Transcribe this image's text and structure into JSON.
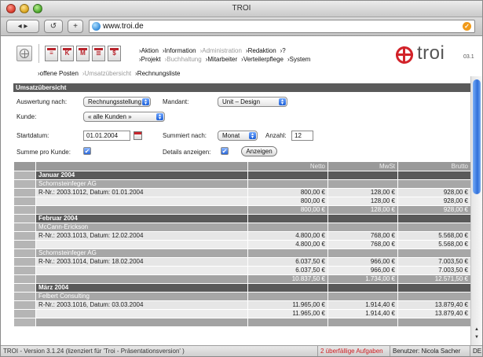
{
  "window": {
    "title": "TROI",
    "back_label": "◂ ▸",
    "reload_label": "↺",
    "add_label": "+",
    "url": "www.troi.de"
  },
  "header": {
    "module_icons": [
      "≡",
      "K",
      "M",
      "≣",
      "$"
    ],
    "menu_row1": [
      {
        "label": "›Aktion",
        "disabled": false
      },
      {
        "label": "›Information",
        "disabled": false
      },
      {
        "label": "›Administration",
        "disabled": true
      },
      {
        "label": "›Redaktion",
        "disabled": false
      },
      {
        "label": "›?",
        "disabled": false
      }
    ],
    "menu_row2": [
      {
        "label": "›Projekt",
        "disabled": false
      },
      {
        "label": "›Buchhaltung",
        "disabled": true
      },
      {
        "label": "›Mitarbeiter",
        "disabled": false
      },
      {
        "label": "›Verteilerpflege",
        "disabled": false
      },
      {
        "label": "›System",
        "disabled": false
      }
    ],
    "logo_text": "troi",
    "logo_version": "03.1"
  },
  "subnav": [
    {
      "label": "›offene Posten",
      "dim": false
    },
    {
      "label": "›Umsatzübersicht",
      "dim": true
    },
    {
      "label": "›Rechnungsliste",
      "dim": false
    }
  ],
  "panel": {
    "title": "Umsatzübersicht"
  },
  "form": {
    "auswertung_label": "Auswertung nach:",
    "auswertung_value": "Rechnungsstellung",
    "mandant_label": "Mandant:",
    "mandant_value": "Unit – Design",
    "kunde_label": "Kunde:",
    "kunde_value": "« alle Kunden »",
    "startdatum_label": "Startdatum:",
    "startdatum_value": "01.01.2004",
    "summiert_label": "Summiert nach:",
    "summiert_value": "Monat",
    "anzahl_label": "Anzahl:",
    "anzahl_value": "12",
    "summe_label": "Summe pro Kunde:",
    "details_label": "Details anzeigen:",
    "anzeigen_label": "Anzeigen",
    "checkmark": "✔"
  },
  "table": {
    "columns": [
      "",
      "",
      "Netto",
      "MwSt",
      "Brutto"
    ],
    "rows": [
      {
        "type": "month",
        "label": "Januar 2004",
        "netto": "",
        "mwst": "",
        "brutto": ""
      },
      {
        "type": "cust",
        "label": "Schornsteinfeger AG",
        "netto": "",
        "mwst": "",
        "brutto": ""
      },
      {
        "type": "inv",
        "label": "R-Nr.: 2003.1012, Datum: 01.01.2004",
        "netto": "800,00 €",
        "mwst": "128,00 €",
        "brutto": "928,00 €"
      },
      {
        "type": "sub",
        "label": "",
        "netto": "800,00 €",
        "mwst": "128,00 €",
        "brutto": "928,00 €"
      },
      {
        "type": "tot",
        "label": "",
        "netto": "800,00 €",
        "mwst": "128,00 €",
        "brutto": "928,00 €"
      },
      {
        "type": "month",
        "label": "Februar 2004",
        "netto": "",
        "mwst": "",
        "brutto": ""
      },
      {
        "type": "cust",
        "label": "McCann-Erickson",
        "netto": "",
        "mwst": "",
        "brutto": ""
      },
      {
        "type": "inv",
        "label": "R-Nr.: 2003.1013, Datum: 12.02.2004",
        "netto": "4.800,00 €",
        "mwst": "768,00 €",
        "brutto": "5.568,00 €"
      },
      {
        "type": "sub",
        "label": "",
        "netto": "4.800,00 €",
        "mwst": "768,00 €",
        "brutto": "5.568,00 €"
      },
      {
        "type": "cust",
        "label": "Schornsteinfeger AG",
        "netto": "",
        "mwst": "",
        "brutto": ""
      },
      {
        "type": "inv",
        "label": "R-Nr.: 2003.1014, Datum: 18.02.2004",
        "netto": "6.037,50 €",
        "mwst": "966,00 €",
        "brutto": "7.003,50 €"
      },
      {
        "type": "sub",
        "label": "",
        "netto": "6.037,50 €",
        "mwst": "966,00 €",
        "brutto": "7.003,50 €"
      },
      {
        "type": "tot",
        "label": "",
        "netto": "10.837,50 €",
        "mwst": "1.734,00 €",
        "brutto": "12.571,50 €"
      },
      {
        "type": "month",
        "label": "März 2004",
        "netto": "",
        "mwst": "",
        "brutto": ""
      },
      {
        "type": "cust",
        "label": "Felbert Consulting",
        "netto": "",
        "mwst": "",
        "brutto": ""
      },
      {
        "type": "inv",
        "label": "R-Nr.: 2003.1016, Datum: 03.03.2004",
        "netto": "11.965,00 €",
        "mwst": "1.914,40 €",
        "brutto": "13.879,40 €"
      },
      {
        "type": "sub",
        "label": "",
        "netto": "11.965,00 €",
        "mwst": "1.914,40 €",
        "brutto": "13.879,40 €"
      },
      {
        "type": "tot",
        "label": "",
        "netto": "",
        "mwst": "",
        "brutto": ""
      }
    ]
  },
  "scrollbar": {
    "up_arrow": "▲",
    "down_arrow": "▼"
  },
  "status": {
    "version": "TROI - Version 3.1.24 (lizenziert für 'Troi - Präsentationsversion' )",
    "warning": "2 überfällige Aufgaben",
    "user": "Benutzer: Nicola Sacher",
    "lang": "DE"
  },
  "colors": {
    "brand_red": "#d2232a",
    "panel_dark": "#5a5a5a",
    "accent_blue": "#2a66d8"
  }
}
